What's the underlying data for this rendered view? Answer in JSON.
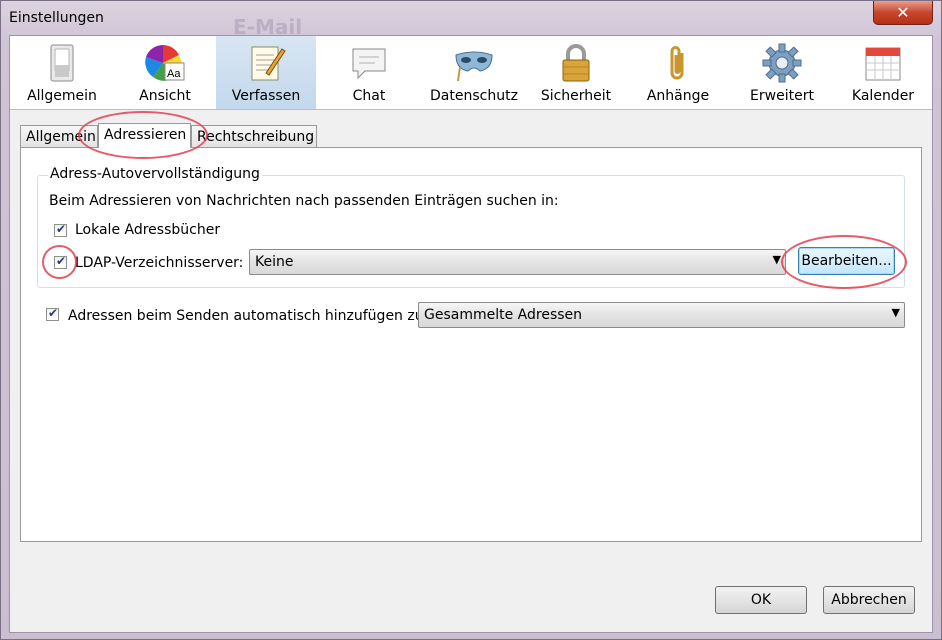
{
  "window": {
    "title": "Einstellungen",
    "background_title": "E-Mail",
    "close_glyph": "✕"
  },
  "toolbar": {
    "items": [
      {
        "label": "Allgemein",
        "icon": "switch-icon"
      },
      {
        "label": "Ansicht",
        "icon": "color-palette-icon"
      },
      {
        "label": "Verfassen",
        "icon": "compose-notepad-icon",
        "selected": true
      },
      {
        "label": "Chat",
        "icon": "chat-bubble-icon"
      },
      {
        "label": "Datenschutz",
        "icon": "mask-icon"
      },
      {
        "label": "Sicherheit",
        "icon": "padlock-icon"
      },
      {
        "label": "Anhänge",
        "icon": "paperclip-icon"
      },
      {
        "label": "Erweitert",
        "icon": "gear-icon"
      },
      {
        "label": "Kalender",
        "icon": "calendar-icon"
      }
    ]
  },
  "tabs": [
    {
      "label": "Allgemein"
    },
    {
      "label": "Adressieren",
      "active": true
    },
    {
      "label": "Rechtschreibung"
    }
  ],
  "autocomplete": {
    "caption": "Adress-Autovervollständigung",
    "description": "Beim Adressieren von Nachrichten nach passenden Einträgen suchen in:",
    "local_books_label": "Lokale Adressbücher",
    "local_books_checked": true,
    "ldap_label": "LDAP-Verzeichnisserver:",
    "ldap_checked": true,
    "ldap_server_value": "Keine",
    "edit_button": "Bearbeiten..."
  },
  "auto_add": {
    "label": "Adressen beim Senden automatisch hinzufügen zu:",
    "checked": true,
    "target_value": "Gesammelte Adressen"
  },
  "footer": {
    "ok": "OK",
    "cancel": "Abbrechen"
  },
  "colors": {
    "annotation_circle": "#e04050",
    "selected_toolbar": "#c3d8ec",
    "close_button": "#c8452c"
  }
}
